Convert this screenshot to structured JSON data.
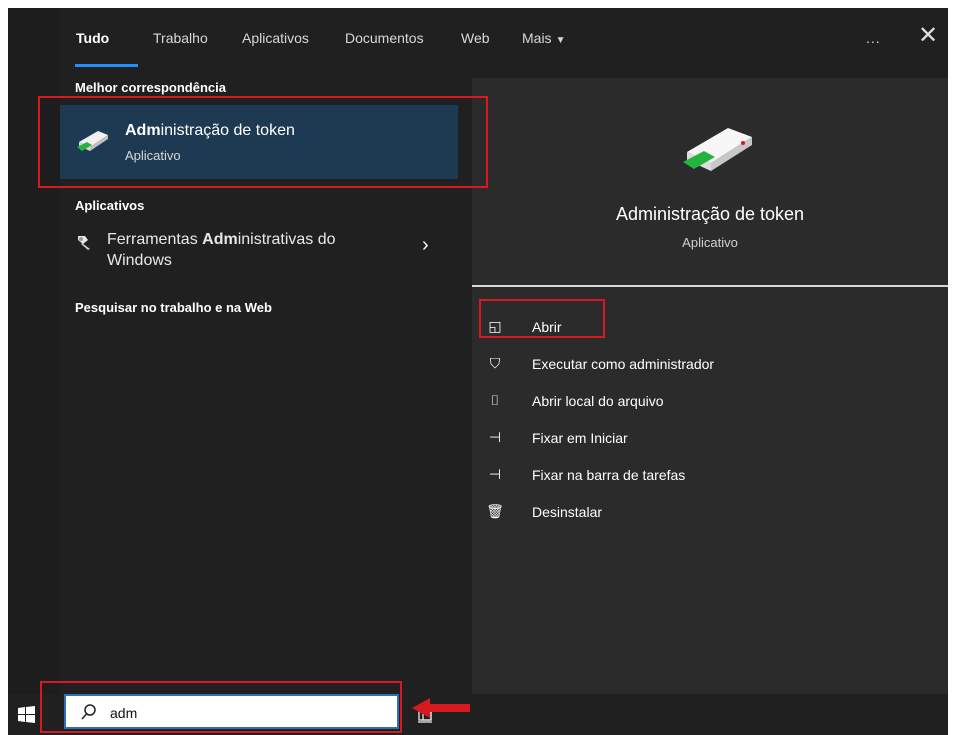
{
  "tabs": [
    "Tudo",
    "Trabalho",
    "Aplicativos",
    "Documentos",
    "Web",
    "Mais"
  ],
  "active_tab": "Tudo",
  "controls": {
    "more_label": "...",
    "close_label": "✕"
  },
  "best_match": {
    "section_title": "Melhor correspondência",
    "name_bold": "Adm",
    "name_rest": "inistração de token",
    "type": "Aplicativo"
  },
  "apps": {
    "section_title": "Aplicativos",
    "item_prefix": "Ferramentas ",
    "item_bold": "Adm",
    "item_suffix": "inistrativas do Windows"
  },
  "web_section": {
    "title": "Pesquisar no trabalho e na Web"
  },
  "preview": {
    "title": "Administração de token",
    "type": "Aplicativo"
  },
  "actions": [
    {
      "label": "Abrir",
      "icon": "open-window-icon"
    },
    {
      "label": "Executar como administrador",
      "icon": "run-as-admin-icon"
    },
    {
      "label": "Abrir local do arquivo",
      "icon": "folder-icon"
    },
    {
      "label": "Fixar em Iniciar",
      "icon": "pin-start-icon"
    },
    {
      "label": "Fixar na barra de tarefas",
      "icon": "pin-taskbar-icon"
    },
    {
      "label": "Desinstalar",
      "icon": "trash-icon"
    }
  ],
  "search": {
    "value": "adm",
    "placeholder": ""
  },
  "colors": {
    "panel": "#202020",
    "preview": "#2b2b2b",
    "selected": "#1e3a52",
    "accent": "#1e90ff",
    "highlight": "#d71920"
  }
}
